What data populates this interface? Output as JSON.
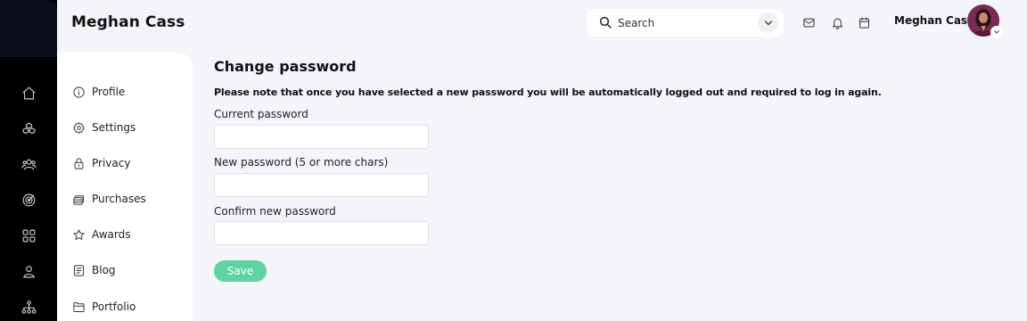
{
  "header": {
    "page_title": "Meghan Cass",
    "search_placeholder": "Search",
    "user_name": "Meghan Cass"
  },
  "sidebar_menu": {
    "items": [
      {
        "label": "Profile",
        "icon": "info-icon"
      },
      {
        "label": "Settings",
        "icon": "gear-icon"
      },
      {
        "label": "Privacy",
        "icon": "lock-icon"
      },
      {
        "label": "Purchases",
        "icon": "stacked-coins-icon"
      },
      {
        "label": "Awards",
        "icon": "star-icon"
      },
      {
        "label": "Blog",
        "icon": "document-list-icon"
      },
      {
        "label": "Portfolio",
        "icon": "folder-icon"
      }
    ]
  },
  "rail": {
    "icons": [
      "home-icon",
      "cubes-icon",
      "people-icon",
      "target-icon",
      "grid-icon",
      "user-icon",
      "hierarchy-icon"
    ]
  },
  "form": {
    "heading": "Change password",
    "notice": "Please note that once you have selected a new password you will be automatically logged out and required to log in again.",
    "current_password_label": "Current password",
    "new_password_label": "New password (5 or more chars)",
    "confirm_password_label": "Confirm new password",
    "save_label": "Save"
  },
  "colors": {
    "rail_background": "#000000",
    "page_background": "#f4f5f9",
    "save_button": "#5fd3a2",
    "avatar_background": "#7a2a55"
  }
}
